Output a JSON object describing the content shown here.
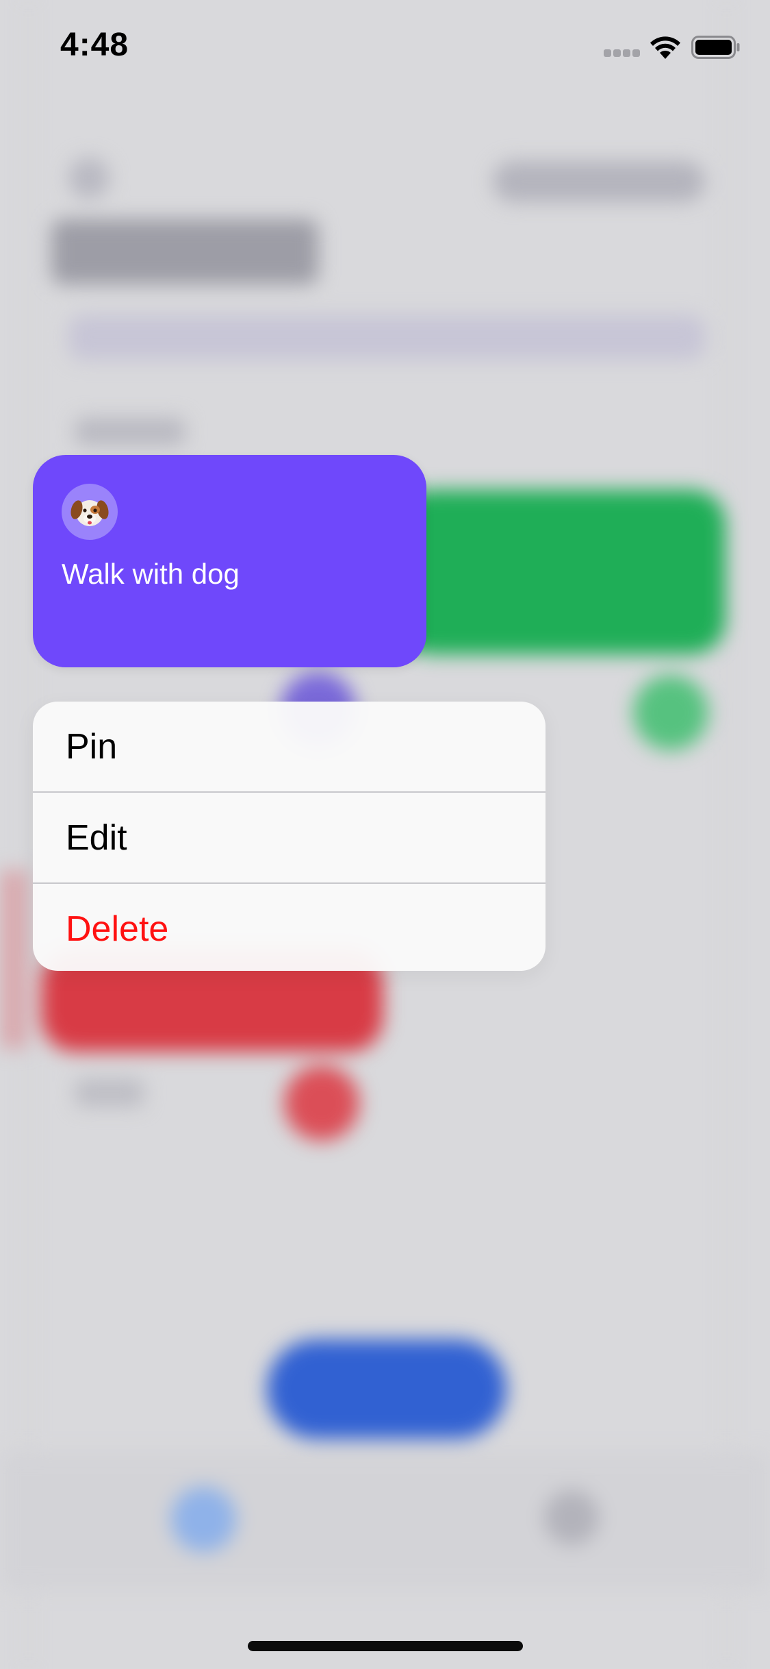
{
  "status_bar": {
    "time": "4:48",
    "signal_icon": "cellular-signal-icon",
    "wifi_icon": "wifi-icon",
    "battery_icon": "battery-icon"
  },
  "preview_card": {
    "emoji": "🐶",
    "emoji_icon": "dog-face-icon",
    "title": "Walk with dog",
    "background_color": "#6f48fb"
  },
  "context_menu": {
    "items": [
      {
        "label": "Pin"
      },
      {
        "label": "Edit"
      },
      {
        "label": "Delete",
        "destructive": true,
        "color": "#ff1111"
      }
    ]
  }
}
